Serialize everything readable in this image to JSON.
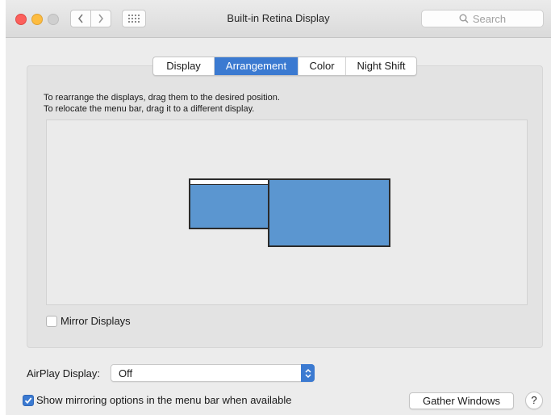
{
  "window": {
    "title": "Built-in Retina Display"
  },
  "toolbar": {
    "back_icon": "chevron-left-icon",
    "forward_icon": "chevron-right-icon",
    "grid_icon": "show-all-grid-icon",
    "search_placeholder": "Search"
  },
  "tabs": [
    {
      "label": "Display",
      "active": false
    },
    {
      "label": "Arrangement",
      "active": true
    },
    {
      "label": "Color",
      "active": false
    },
    {
      "label": "Night Shift",
      "active": false
    }
  ],
  "arrangement": {
    "instruction_1": "To rearrange the displays, drag them to the desired position.",
    "instruction_2": "To relocate the menu bar, drag it to a different display.",
    "displays": [
      {
        "role": "main-display-with-menubar",
        "color": "#5b96d0"
      },
      {
        "role": "secondary-display",
        "color": "#5b96d0"
      }
    ]
  },
  "mirror": {
    "label": "Mirror Displays",
    "checked": false
  },
  "airplay": {
    "label": "AirPlay Display:",
    "value": "Off"
  },
  "show_mirroring": {
    "label": "Show mirroring options in the menu bar when available",
    "checked": true
  },
  "buttons": {
    "gather": "Gather Windows",
    "help": "?"
  },
  "colors": {
    "accent": "#3b7ad1",
    "window_bg": "#ececec",
    "close": "#fc605c",
    "minimize": "#fdbc40",
    "maximize_disabled": "#cfcfcf"
  }
}
